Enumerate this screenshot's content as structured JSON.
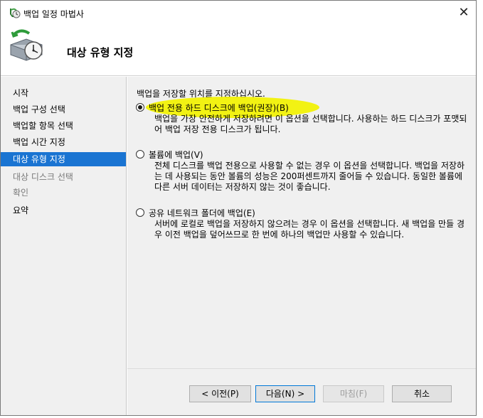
{
  "window": {
    "title": "백업 일정 마법사",
    "close_label": "✕"
  },
  "header": {
    "title": "대상 유형 지정"
  },
  "sidebar": {
    "items": [
      {
        "label": "시작",
        "state": "normal"
      },
      {
        "label": "백업 구성 선택",
        "state": "normal"
      },
      {
        "label": "백업할 항목 선택",
        "state": "normal"
      },
      {
        "label": "백업 시간 지정",
        "state": "normal"
      },
      {
        "label": "대상 유형 지정",
        "state": "active"
      },
      {
        "label": "대상 디스크 선택",
        "state": "dim"
      },
      {
        "label": "확인",
        "state": "dim"
      },
      {
        "label": "요약",
        "state": "normal"
      }
    ]
  },
  "main": {
    "instruction": "백업을 저장할 위치를 지정하십시오.",
    "options": [
      {
        "label": "백업 전용 하드 디스크에 백업(권장)(B)",
        "description": "백업을 가장 안전하게 저장하려면 이 옵션을 선택합니다. 사용하는 하드 디스크가 포맷되어 백업 저장 전용 디스크가 됩니다.",
        "checked": true
      },
      {
        "label": "볼륨에 백업(V)",
        "description": "전체 디스크를 백업 전용으로 사용할 수 없는 경우 이 옵션을 선택합니다. 백업을 저장하는 데 사용되는 동안 볼륨의 성능은 200퍼센트까지 줄어들 수 있습니다. 동일한 볼륨에 다른 서버 데이터는 저장하지 않는 것이 좋습니다.",
        "checked": false
      },
      {
        "label": "공유 네트워크 폴더에 백업(E)",
        "description": "서버에 로컬로 백업을 저장하지 않으려는 경우 이 옵션을 선택합니다. 새 백업을 만들 경우 이전 백업을 덮어쓰므로 한 번에 하나의 백업만 사용할 수 있습니다.",
        "checked": false
      }
    ]
  },
  "buttons": {
    "prev": "< 이전(P)",
    "next": "다음(N) >",
    "finish": "마침(F)",
    "cancel": "취소"
  },
  "colors": {
    "active_nav": "#1a74d2",
    "highlight": "#f2f200",
    "panel_bg": "#f0f0f0"
  },
  "icons": {
    "title": "backup-clock-icon",
    "header": "backup-disk-clock-icon",
    "close": "close-icon"
  }
}
